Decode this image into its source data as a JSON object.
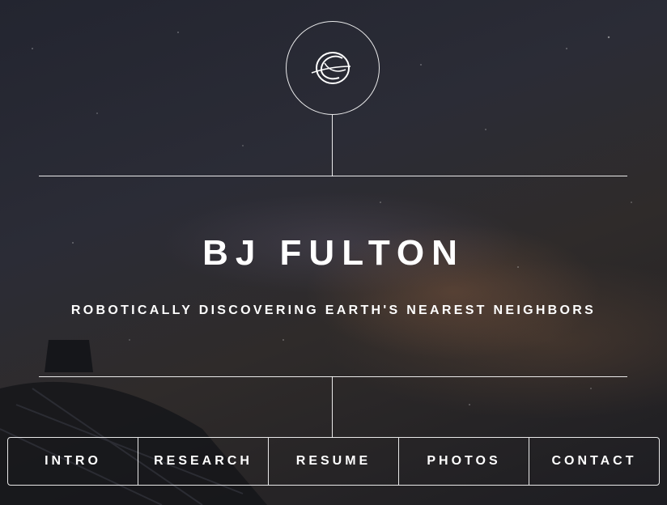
{
  "header": {
    "logo_icon": "scribble-circle-logo-icon"
  },
  "hero": {
    "title": "BJ FULTON",
    "subtitle": "ROBOTICALLY DISCOVERING EARTH'S NEAREST NEIGHBORS"
  },
  "nav": {
    "items": [
      {
        "label": "INTRO"
      },
      {
        "label": "RESEARCH"
      },
      {
        "label": "RESUME"
      },
      {
        "label": "PHOTOS"
      },
      {
        "label": "CONTACT"
      }
    ]
  },
  "colors": {
    "foreground": "#ffffff",
    "background": "#1b1c22"
  }
}
